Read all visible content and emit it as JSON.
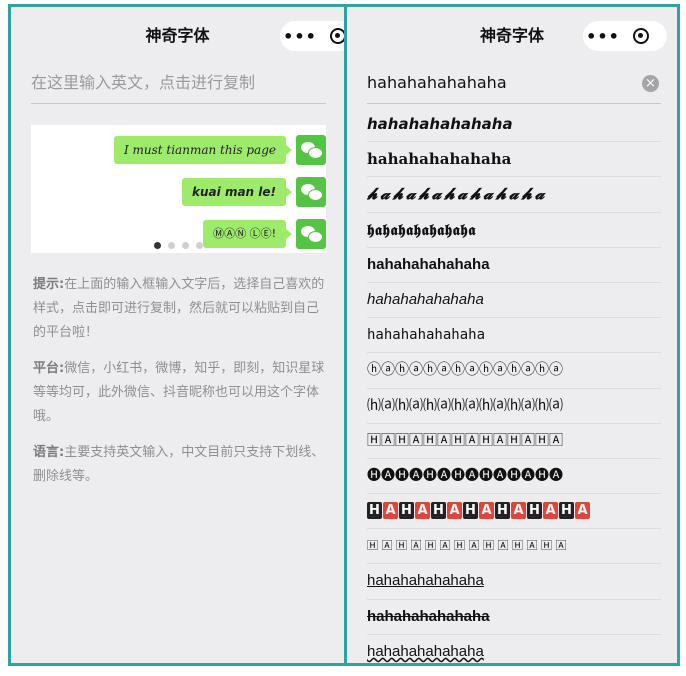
{
  "left": {
    "nav_title": "神奇字体",
    "more_glyph": "•••",
    "input_placeholder": "在这里输入英文，点击进行复制",
    "chat": [
      {
        "text": "I must tianman this page"
      },
      {
        "text": "kuai man le!"
      },
      {
        "text": "ⓂⒶⓃ ⓁⒺ!"
      }
    ],
    "tips": [
      {
        "label": "提示:",
        "text": "在上面的输入框输入文字后，选择自己喜欢的样式，点击即可进行复制，然后就可以粘贴到自己的平台啦！"
      },
      {
        "label": "平台:",
        "text": "微信，小红书，微博，知乎，即刻，知识星球等等均可，此外微信、抖音昵称也可以用这个字体哦。"
      },
      {
        "label": "语言:",
        "text": "主要支持英文输入，中文目前只支持下划线、删除线等。"
      }
    ]
  },
  "right": {
    "nav_title": "神奇字体",
    "more_glyph": "•••",
    "input_value": "hahahahahahaha",
    "clear_glyph": "×",
    "fonts": [
      "hahahahahahaha",
      "hahahahahahaha",
      "𝓱𝓪𝓱𝓪𝓱𝓪𝓱𝓪𝓱𝓪𝓱𝓪𝓱𝓪",
      "𝖍𝖆𝖍𝖆𝖍𝖆𝖍𝖆𝖍𝖆𝖍𝖆𝖍𝖆",
      "hahahahahahaha",
      "hahahahahahaha",
      "hahahahahahaha",
      "ⓗⓐⓗⓐⓗⓐⓗⓐⓗⓐⓗⓐⓗⓐ",
      "⒣⒜⒣⒜⒣⒜⒣⒜⒣⒜⒣⒜⒣⒜",
      "🄷🄰🄷🄰🄷🄰🄷🄰🄷🄰🄷🄰🄷🄰",
      "🅗🅐🅗🅐🅗🅐🅗🅐🅗🅐🅗🅐🅗🅐",
      "HAHAHAHAHAHAHA",
      "🄷 🄰 🄷 🄰 🄷 🄰 🄷 🄰 🄷 🄰 🄷 🄰 🄷 🄰",
      "hahahahahahaha",
      "hahahahahahaha",
      "hahahahahahaha"
    ]
  }
}
